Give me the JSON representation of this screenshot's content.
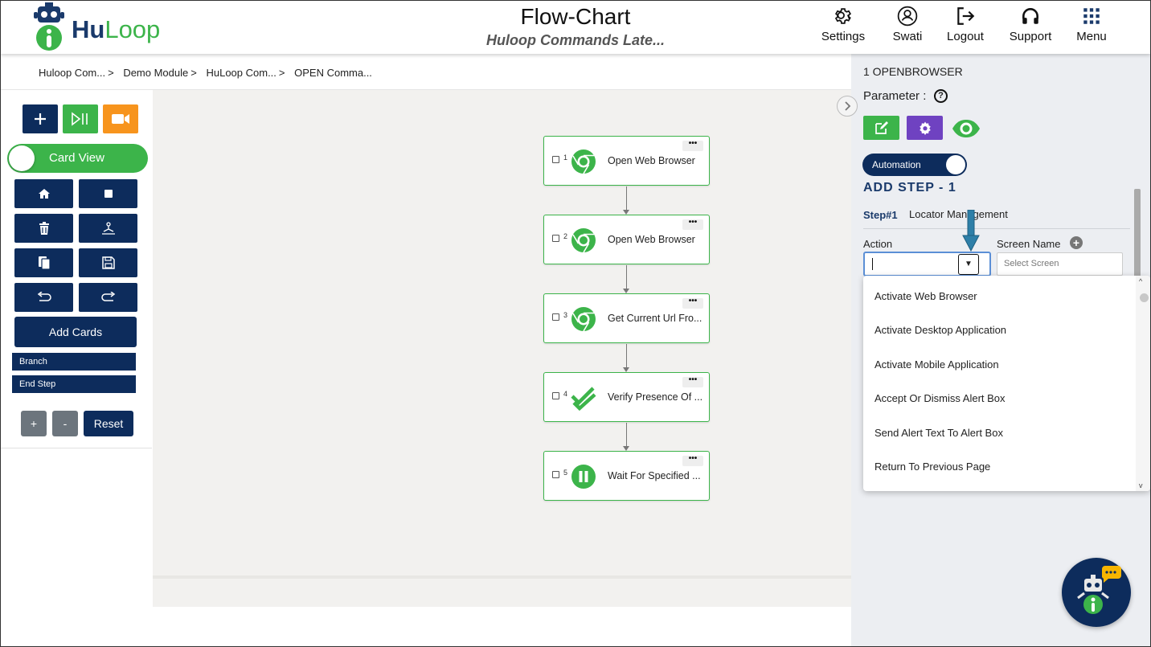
{
  "header": {
    "logo_hu": "Hu",
    "logo_loop": "Loop",
    "title": "Flow-Chart",
    "subtitle": "Huloop Commands Late...",
    "nav": [
      {
        "label": "Settings",
        "icon": "gear-icon"
      },
      {
        "label": "Swati",
        "icon": "user-avatar-icon"
      },
      {
        "label": "Logout",
        "icon": "logout-icon"
      },
      {
        "label": "Support",
        "icon": "headphones-icon"
      },
      {
        "label": "Menu",
        "icon": "grid-menu-icon"
      }
    ]
  },
  "breadcrumb": [
    "Huloop Com...",
    "Demo Module",
    "HuLoop Com...",
    "OPEN Comma..."
  ],
  "toolbar": {
    "card_view_label": "Card View",
    "add_cards_label": "Add Cards",
    "branch_label": "Branch",
    "end_step_label": "End Step",
    "zoom_in_label": "+",
    "zoom_out_label": "-",
    "reset_label": "Reset"
  },
  "cards": [
    {
      "num": "1",
      "label": "Open Web Browser",
      "icon": "chrome-icon"
    },
    {
      "num": "2",
      "label": "Open Web Browser",
      "icon": "chrome-icon"
    },
    {
      "num": "3",
      "label": "Get Current Url Fro...",
      "icon": "chrome-icon"
    },
    {
      "num": "4",
      "label": "Verify Presence Of ...",
      "icon": "double-check-icon"
    },
    {
      "num": "5",
      "label": "Wait For Specified ...",
      "icon": "pause-icon"
    }
  ],
  "panel": {
    "step_title": "1 OPENBROWSER",
    "parameter_label": "Parameter :",
    "help_label": "?",
    "automation_label": "Automation",
    "add_step_label": "ADD STEP - 1",
    "step_number": "Step#1",
    "step_label": "Locator Management",
    "action_label": "Action",
    "screen_name_label": "Screen Name",
    "screen_placeholder": "Select Screen",
    "action_options": [
      "Activate Web Browser",
      "Activate Desktop Application",
      "Activate Mobile Application",
      "Accept Or Dismiss Alert Box",
      "Send Alert Text To Alert Box",
      "Return To Previous Page"
    ]
  },
  "colors": {
    "navy": "#0d2c5c",
    "green": "#3cb44a",
    "orange": "#f7941d",
    "purple": "#6f42c1",
    "arrow": "#2e7fa8"
  }
}
